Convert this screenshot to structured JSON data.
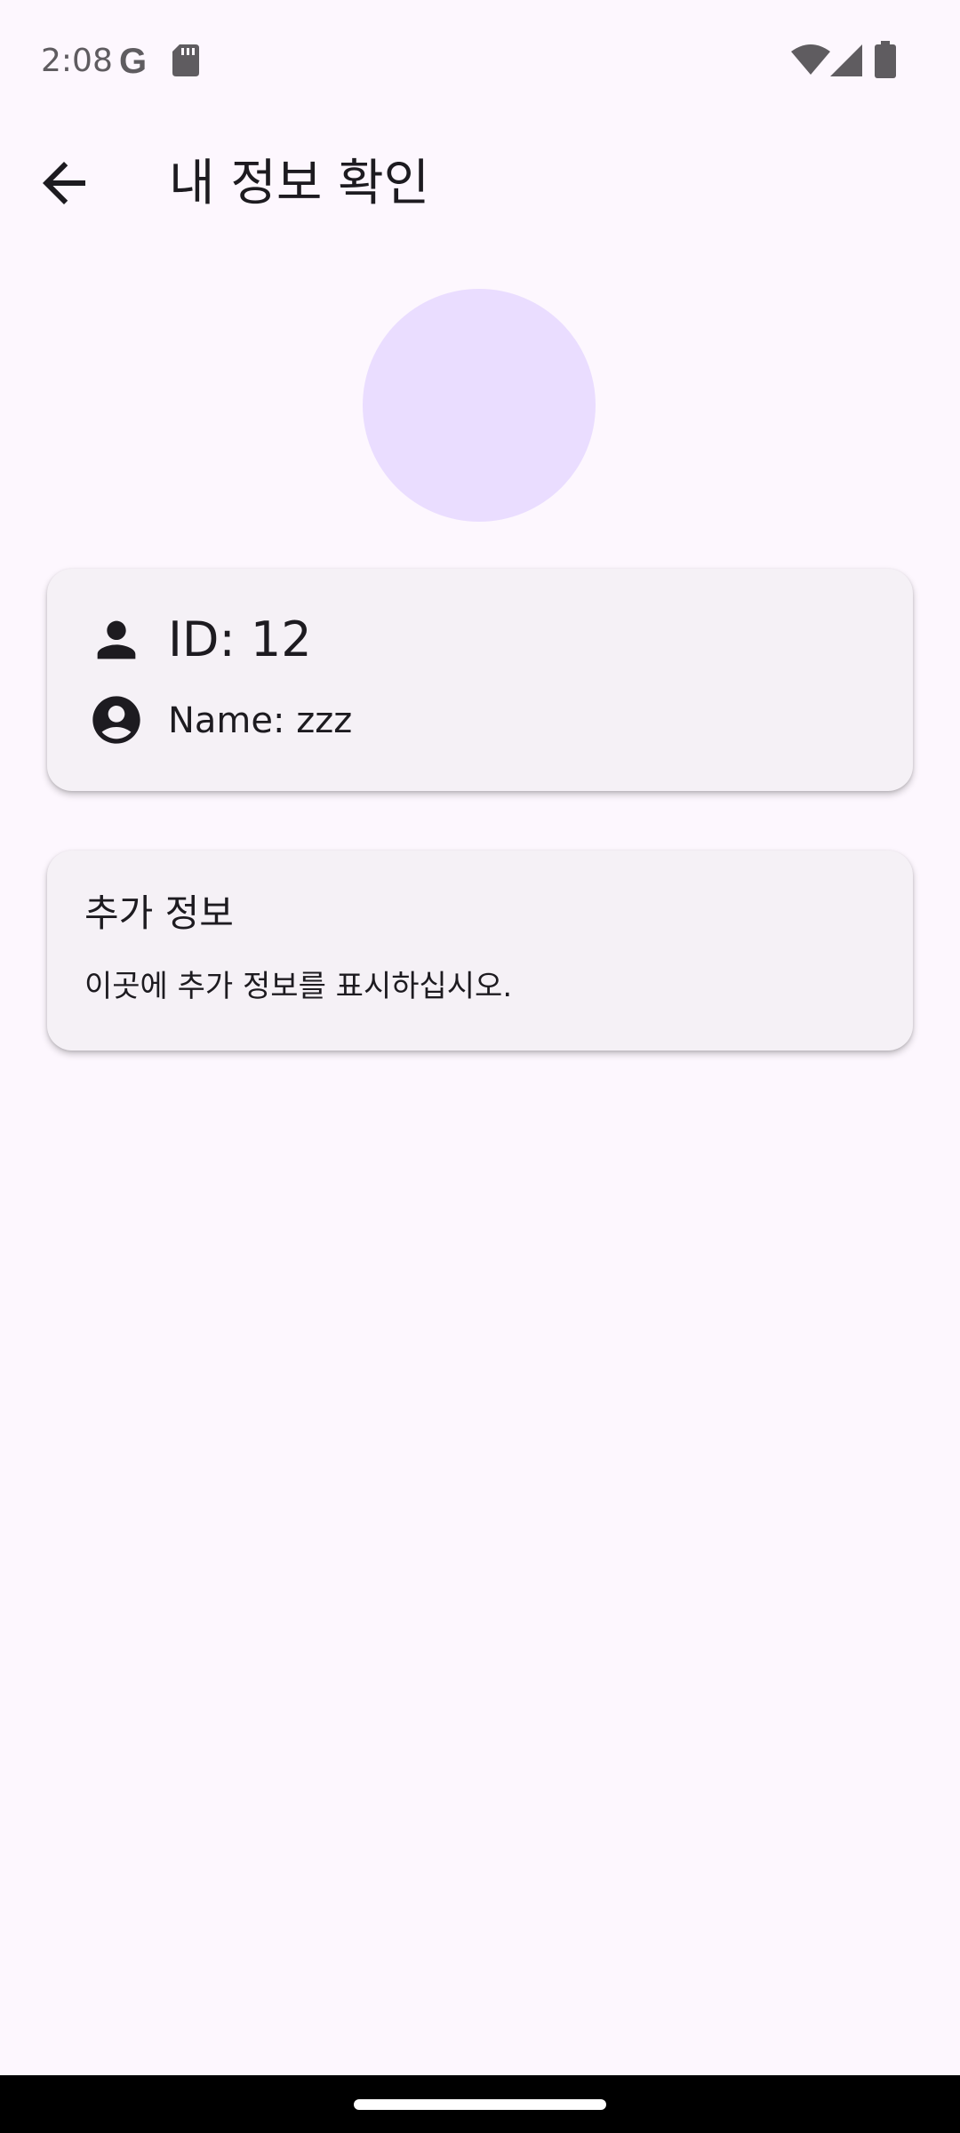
{
  "status_bar": {
    "time": "2:08",
    "google_glyph": "G",
    "icons": [
      "google-icon",
      "sd-card-icon",
      "wifi-icon",
      "signal-icon",
      "battery-icon"
    ]
  },
  "app_bar": {
    "title": "내 정보 확인",
    "back_icon": "arrow-back-icon"
  },
  "profile": {
    "avatar_color": "#EADDFF"
  },
  "info_card": {
    "id_text": "ID: 12",
    "name_text": "Name: zzz",
    "id_icon": "person-icon",
    "name_icon": "account-circle-icon"
  },
  "extra_card": {
    "title": "추가 정보",
    "body": "이곳에 추가 정보를 표시하십시오."
  },
  "colors": {
    "background": "#FDF7FE",
    "card": "#F5F1F6",
    "text": "#1D1B20",
    "status_icon": "#5F5C60"
  }
}
